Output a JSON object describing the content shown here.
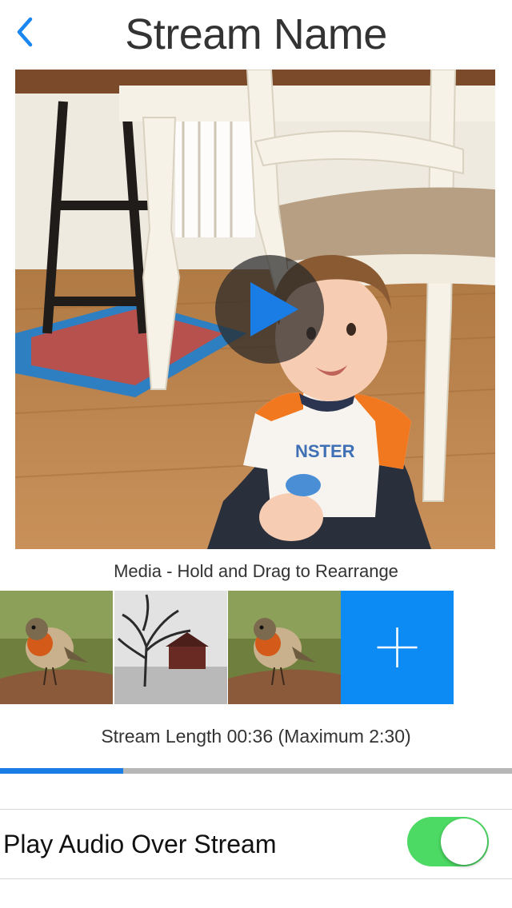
{
  "nav": {
    "title": "Stream Name",
    "back_icon": "chevron-left-icon"
  },
  "player": {
    "play_icon": "play-icon"
  },
  "media": {
    "caption": "Media - Hold and Drag to Rearrange",
    "add_icon": "plus-icon",
    "accent_color": "#0c8bf5"
  },
  "stream": {
    "length_text": "Stream Length 00:36 (Maximum 2:30)",
    "elapsed": "00:36",
    "maximum": "2:30",
    "progress_fraction": 0.24
  },
  "settings": {
    "audio_label": "Play Audio Over Stream",
    "audio_on": true
  }
}
